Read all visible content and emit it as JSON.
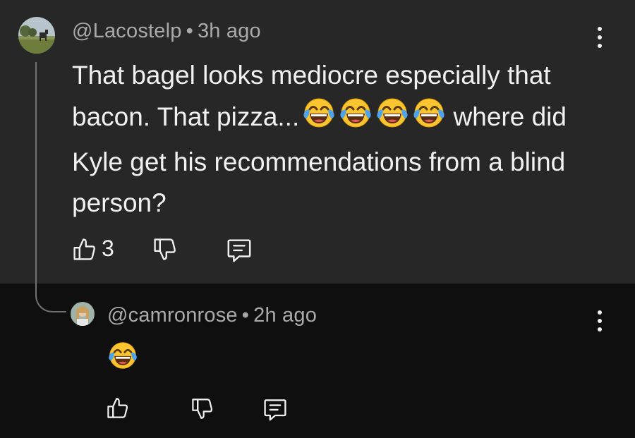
{
  "comment": {
    "author": "@Lacostelp",
    "separator": "•",
    "time": "3h ago",
    "text": "That bagel looks mediocre especially that bacon. That pizza...",
    "text_after": "where did Kyle get his recommendations from a blind person?",
    "emoji_count": 4,
    "like_count": "3"
  },
  "reply": {
    "author": "@camronrose",
    "separator": "•",
    "time": "2h ago"
  },
  "icons": {
    "like": "thumbs-up-icon",
    "dislike": "thumbs-down-icon",
    "reply": "comment-icon",
    "menu": "more-vertical-icon",
    "emoji": "face-with-tears-of-joy"
  },
  "colors": {
    "top_background": "#272727",
    "bottom_background": "#0f0f0f",
    "text": "#f1f1f1",
    "meta": "#aaaaaa"
  }
}
